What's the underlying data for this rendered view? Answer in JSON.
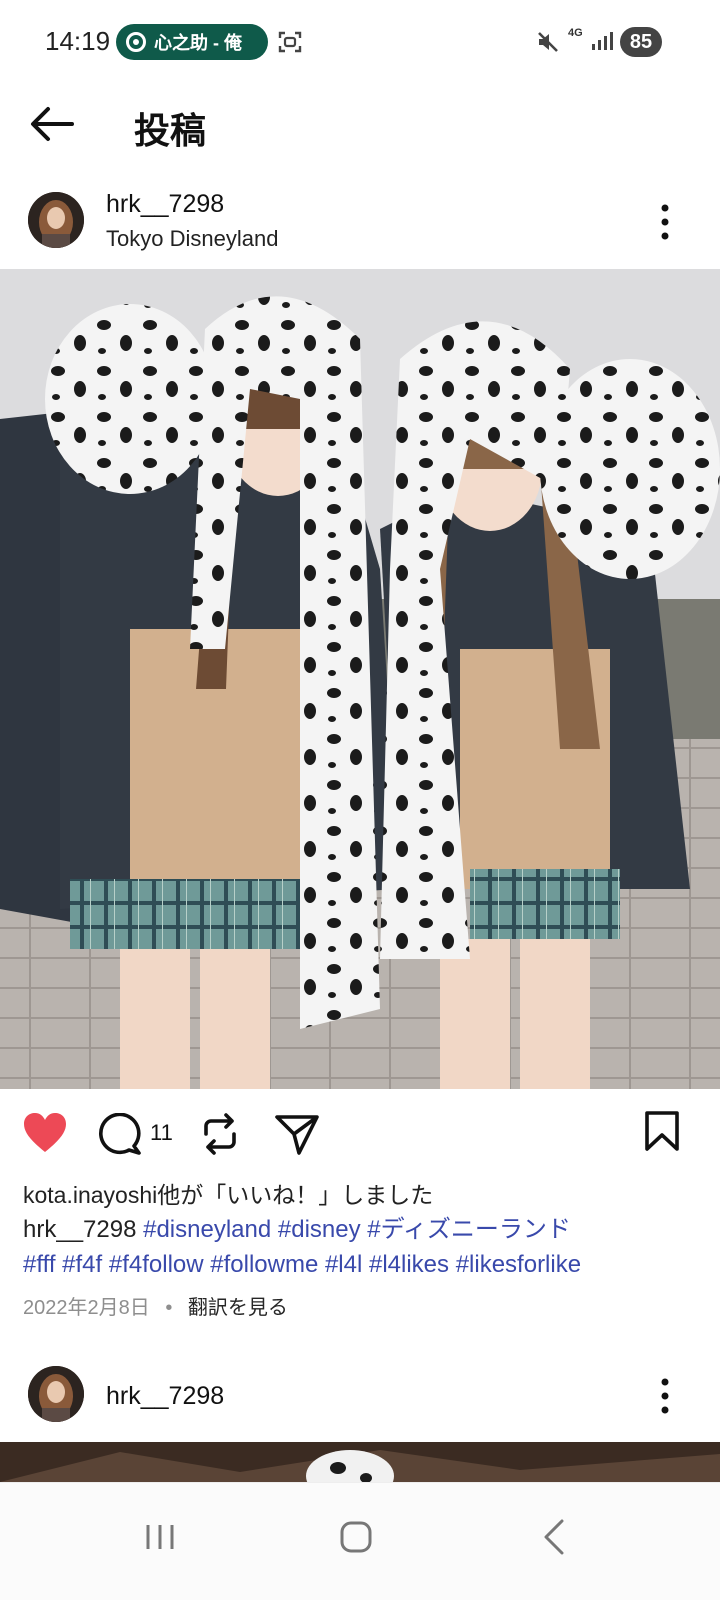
{
  "status_bar": {
    "time": "14:19",
    "pill_text": "心之助 - 俺",
    "network": "4G",
    "battery": "85",
    "icons": [
      "screenshot-icon",
      "mute-icon",
      "signal-icon"
    ]
  },
  "header": {
    "title": "投稿",
    "back_icon": "arrow-left-icon"
  },
  "post": {
    "username": "hrk__7298",
    "location": "Tokyo Disneyland",
    "comment_count": "11",
    "liked": true,
    "likes_text": "kota.inayoshi他が「いいね！」しました",
    "caption_user": "hrk__7298",
    "caption_tags_line1": "#disneyland #disney  #ディズニーランド",
    "caption_tags_line2": "#fff #f4f #f4follow #followme #l4l #l4likes #likesforlike",
    "date": "2022年2月8日",
    "dot": "•",
    "translate": "翻訳を見る"
  },
  "post2": {
    "username": "hrk__7298"
  },
  "colors": {
    "heart": "#ed4956",
    "hashtag": "#3949ab",
    "pill_bg": "#0f5a4a"
  },
  "navbar": {
    "icons": [
      "recent-apps-icon",
      "home-icon",
      "back-icon"
    ]
  }
}
